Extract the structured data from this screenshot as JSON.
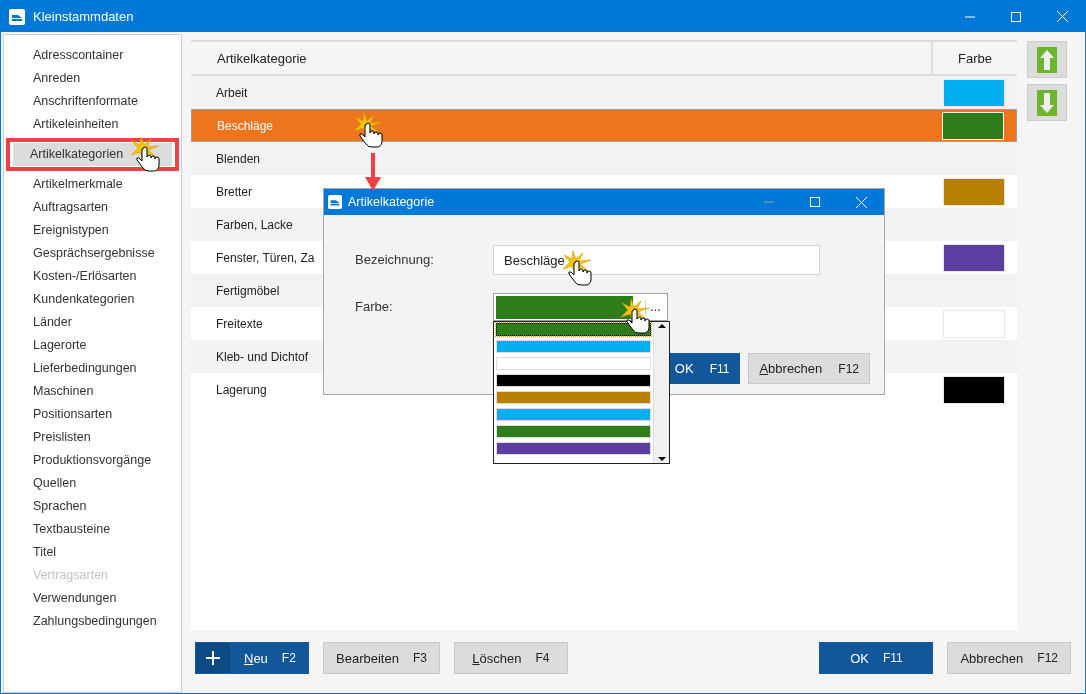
{
  "window": {
    "title": "Kleinstammdaten"
  },
  "sidebar": {
    "items": [
      {
        "label": "Adresscontainer",
        "selected": false,
        "disabled": false
      },
      {
        "label": "Anreden",
        "selected": false,
        "disabled": false
      },
      {
        "label": "Anschriftenformate",
        "selected": false,
        "disabled": false
      },
      {
        "label": "Artikeleinheiten",
        "selected": false,
        "disabled": false
      },
      {
        "label": "Artikelkategorien",
        "selected": true,
        "disabled": false
      },
      {
        "label": "Artikelmerkmale",
        "selected": false,
        "disabled": false
      },
      {
        "label": "Auftragsarten",
        "selected": false,
        "disabled": false
      },
      {
        "label": "Ereignistypen",
        "selected": false,
        "disabled": false
      },
      {
        "label": "Gesprächsergebnisse",
        "selected": false,
        "disabled": false
      },
      {
        "label": "Kosten-/Erlösarten",
        "selected": false,
        "disabled": false
      },
      {
        "label": "Kundenkategorien",
        "selected": false,
        "disabled": false
      },
      {
        "label": "Länder",
        "selected": false,
        "disabled": false
      },
      {
        "label": "Lagerorte",
        "selected": false,
        "disabled": false
      },
      {
        "label": "Lieferbedingungen",
        "selected": false,
        "disabled": false
      },
      {
        "label": "Maschinen",
        "selected": false,
        "disabled": false
      },
      {
        "label": "Positionsarten",
        "selected": false,
        "disabled": false
      },
      {
        "label": "Preislisten",
        "selected": false,
        "disabled": false
      },
      {
        "label": "Produktionsvorgänge",
        "selected": false,
        "disabled": false
      },
      {
        "label": "Quellen",
        "selected": false,
        "disabled": false
      },
      {
        "label": "Sprachen",
        "selected": false,
        "disabled": false
      },
      {
        "label": "Textbausteine",
        "selected": false,
        "disabled": false
      },
      {
        "label": "Titel",
        "selected": false,
        "disabled": false
      },
      {
        "label": "Vertragsarten",
        "selected": false,
        "disabled": true
      },
      {
        "label": "Verwendungen",
        "selected": false,
        "disabled": false
      },
      {
        "label": "Zahlungsbedingungen",
        "selected": false,
        "disabled": false
      }
    ]
  },
  "table": {
    "columns": [
      "Artikelkategorie",
      "Farbe"
    ],
    "rows": [
      {
        "label": "Arbeit",
        "color": "#00b0f0",
        "selected": false
      },
      {
        "label": "Beschläge",
        "color": "#2e7d1a",
        "selected": true
      },
      {
        "label": "Blenden",
        "selected": false
      },
      {
        "label": "Bretter",
        "color": "#b88000",
        "selected": false
      },
      {
        "label": "Farben, Lacke",
        "selected": false
      },
      {
        "label": "Fenster, Türen, Za",
        "color": "#5b3ea0",
        "selected": false
      },
      {
        "label": "Fertigmöbel",
        "selected": false
      },
      {
        "label": "Freitexte",
        "color": "#ffffff",
        "selected": false
      },
      {
        "label": "Kleb- und Dichtof",
        "selected": false
      },
      {
        "label": "Lagerung",
        "color": "#000000",
        "selected": false
      }
    ]
  },
  "left_buttons": [
    {
      "label": "Neu",
      "key": "F2",
      "kind": "add",
      "mnemonic": true
    },
    {
      "label": "Bearbeiten",
      "key": "F3",
      "kind": "secondary",
      "mnemonic": false
    },
    {
      "label": "Löschen",
      "key": "F4",
      "kind": "secondary",
      "mnemonic": true
    }
  ],
  "right_buttons": [
    {
      "label": "OK",
      "key": "F11",
      "kind": "primary",
      "mnemonic": false
    },
    {
      "label": "Abbrechen",
      "key": "F12",
      "kind": "secondary",
      "mnemonic": false
    }
  ],
  "dialog": {
    "title": "Artikelkategorie",
    "name_field": {
      "label": "Bezeichnung:",
      "value": "Beschläge"
    },
    "color_field": {
      "label": "Farbe:",
      "color": "#2e7d1a",
      "more": "...",
      "options": [
        {
          "color": "#2e7d1a",
          "selected": true
        },
        {
          "color": "#00b0f0",
          "selected": false
        },
        {
          "color": "#ffffff",
          "selected": false
        },
        {
          "color": "#000000",
          "selected": false
        },
        {
          "color": "#b88000",
          "selected": false
        },
        {
          "color": "#00b0f0",
          "selected": false
        },
        {
          "color": "#2e7d1a",
          "selected": false
        },
        {
          "color": "#5b3ea0",
          "selected": false
        }
      ]
    },
    "buttons": [
      {
        "label": "OK",
        "key": "F11",
        "kind": "primary",
        "mnemonic": false
      },
      {
        "label": "Abbrechen",
        "key": "F12",
        "kind": "secondary",
        "mnemonic": true
      }
    ]
  }
}
